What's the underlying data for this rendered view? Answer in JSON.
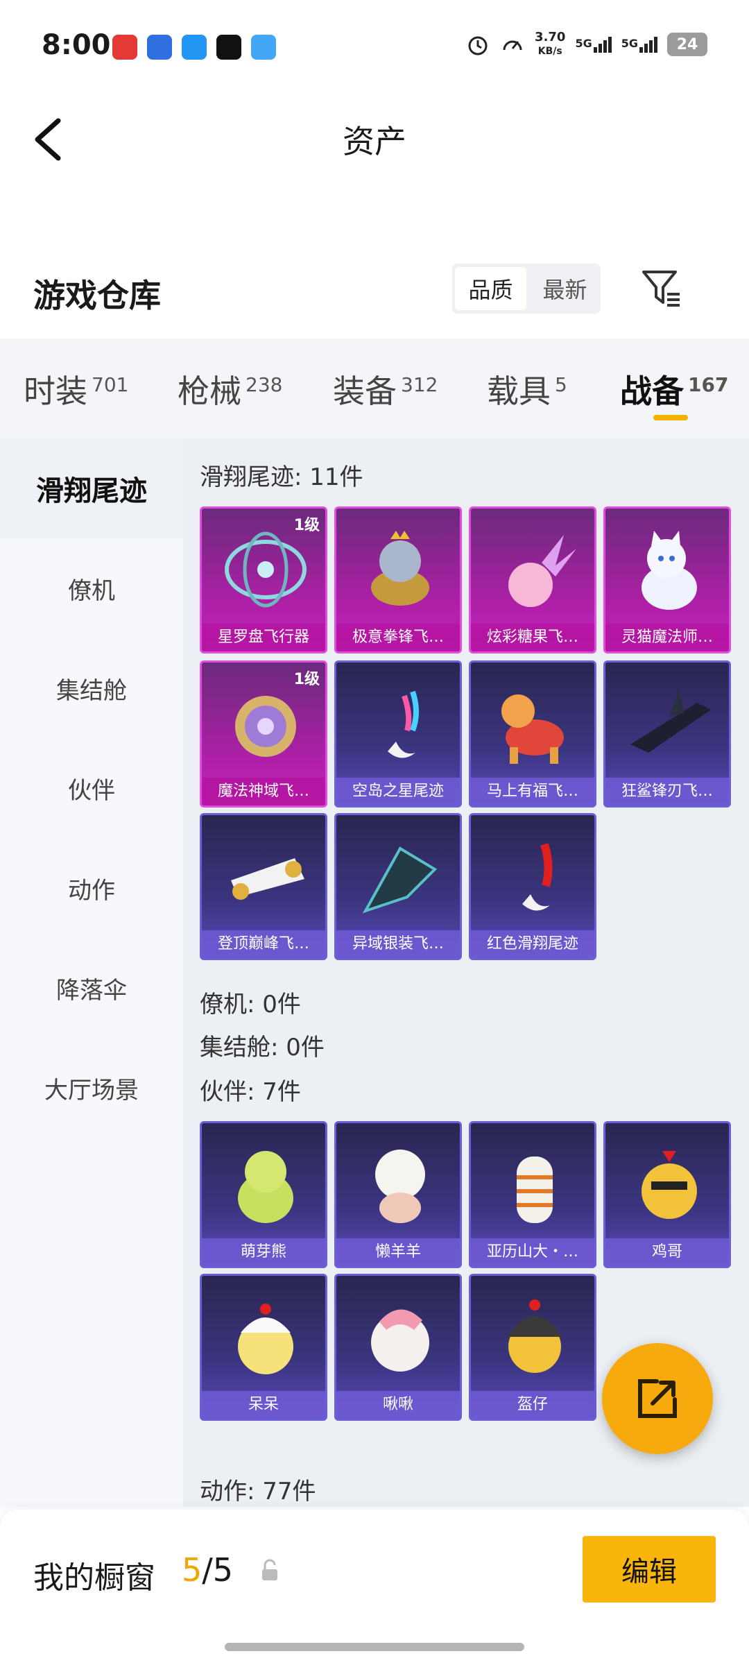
{
  "status_bar": {
    "time": "8:00",
    "net_speed_value": "3.70",
    "net_speed_unit": "KB/s",
    "sim1": "5G",
    "sim2": "5G",
    "battery": "24"
  },
  "nav": {
    "title": "资产"
  },
  "header": {
    "title": "游戏仓库",
    "sort_options": [
      {
        "label": "品质",
        "active": true
      },
      {
        "label": "最新",
        "active": false
      }
    ]
  },
  "tabs": [
    {
      "label": "时装",
      "count": "701",
      "active": false
    },
    {
      "label": "枪械",
      "count": "238",
      "active": false
    },
    {
      "label": "装备",
      "count": "312",
      "active": false
    },
    {
      "label": "载具",
      "count": "5",
      "active": false
    },
    {
      "label": "战备",
      "count": "167",
      "active": true
    }
  ],
  "sidebar": {
    "items": [
      {
        "label": "滑翔尾迹",
        "active": true
      },
      {
        "label": "僚机",
        "active": false
      },
      {
        "label": "集结舱",
        "active": false
      },
      {
        "label": "伙伴",
        "active": false
      },
      {
        "label": "动作",
        "active": false
      },
      {
        "label": "降落伞",
        "active": false
      },
      {
        "label": "大厅场景",
        "active": false
      }
    ]
  },
  "groups": {
    "glide": {
      "title": "滑翔尾迹: 11件",
      "items": [
        {
          "name": "星罗盘飞行器",
          "quality": "purple",
          "level": "1级"
        },
        {
          "name": "极意拳锋飞…",
          "quality": "purple",
          "level": ""
        },
        {
          "name": "炫彩糖果飞…",
          "quality": "purple",
          "level": ""
        },
        {
          "name": "灵猫魔法师…",
          "quality": "purple",
          "level": ""
        },
        {
          "name": "魔法神域飞…",
          "quality": "purple",
          "level": "1级"
        },
        {
          "name": "空岛之星尾迹",
          "quality": "blue",
          "level": ""
        },
        {
          "name": "马上有福飞…",
          "quality": "blue",
          "level": ""
        },
        {
          "name": "狂鲨锋刃飞…",
          "quality": "blue",
          "level": ""
        },
        {
          "name": "登顶巅峰飞…",
          "quality": "blue",
          "level": ""
        },
        {
          "name": "异域银装飞…",
          "quality": "blue",
          "level": ""
        },
        {
          "name": "红色滑翔尾迹",
          "quality": "blue",
          "level": ""
        }
      ]
    },
    "wingman": {
      "title": "僚机: 0件"
    },
    "capsule": {
      "title": "集结舱: 0件"
    },
    "partner": {
      "title": "伙伴: 7件",
      "items": [
        {
          "name": "萌芽熊",
          "quality": "blue"
        },
        {
          "name": "懒羊羊",
          "quality": "blue"
        },
        {
          "name": "亚历山大・…",
          "quality": "blue"
        },
        {
          "name": "鸡哥",
          "quality": "blue"
        },
        {
          "name": "呆呆",
          "quality": "blue"
        },
        {
          "name": "啾啾",
          "quality": "blue"
        },
        {
          "name": "盔仔",
          "quality": "blue"
        }
      ]
    },
    "action": {
      "title": "动作: 77件"
    }
  },
  "footer": {
    "title": "我的橱窗",
    "count_current": "5",
    "count_total": "/5",
    "edit_label": "编辑"
  },
  "colors": {
    "accent": "#f9b50c",
    "quality_purple": "#c02ac0",
    "quality_blue": "#5a48b8"
  }
}
